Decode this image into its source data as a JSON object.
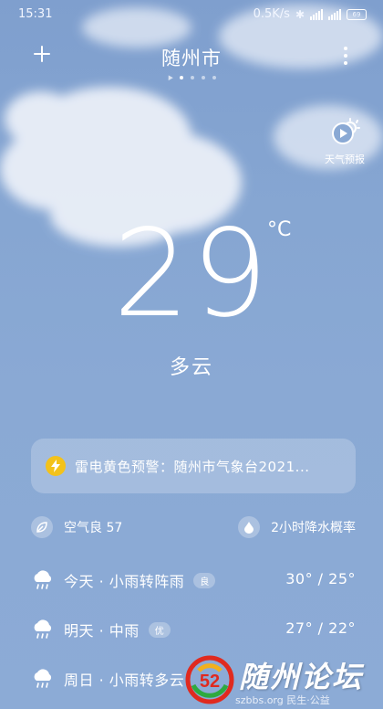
{
  "status_bar": {
    "time": "15:31",
    "net_speed": "0.5K/s",
    "battery": "69"
  },
  "header": {
    "city": "随州市",
    "add_icon": "plus-icon",
    "more_icon": "more-vertical-icon"
  },
  "video_forecast": {
    "label": "天气预报",
    "icon": "play-sun-icon"
  },
  "current": {
    "temperature": "29",
    "unit": "°C",
    "condition": "多云"
  },
  "alert": {
    "text": "雷电黄色预警：随州市气象台2021...",
    "icon": "lightning-icon",
    "color": "#f3c21b"
  },
  "info": {
    "aqi_label": "空气良 57",
    "rain_label": "2小时降水概率"
  },
  "forecast": [
    {
      "label": "今天 · 小雨转阵雨",
      "quality": "良",
      "range": "30° / 25°"
    },
    {
      "label": "明天 · 中雨",
      "quality": "优",
      "range": "27° / 22°"
    },
    {
      "label": "周日 · 小雨转多云",
      "quality": "",
      "range": ""
    }
  ],
  "watermark": {
    "title": "随州论坛",
    "sub": "szbbs.org 民生·公益"
  }
}
